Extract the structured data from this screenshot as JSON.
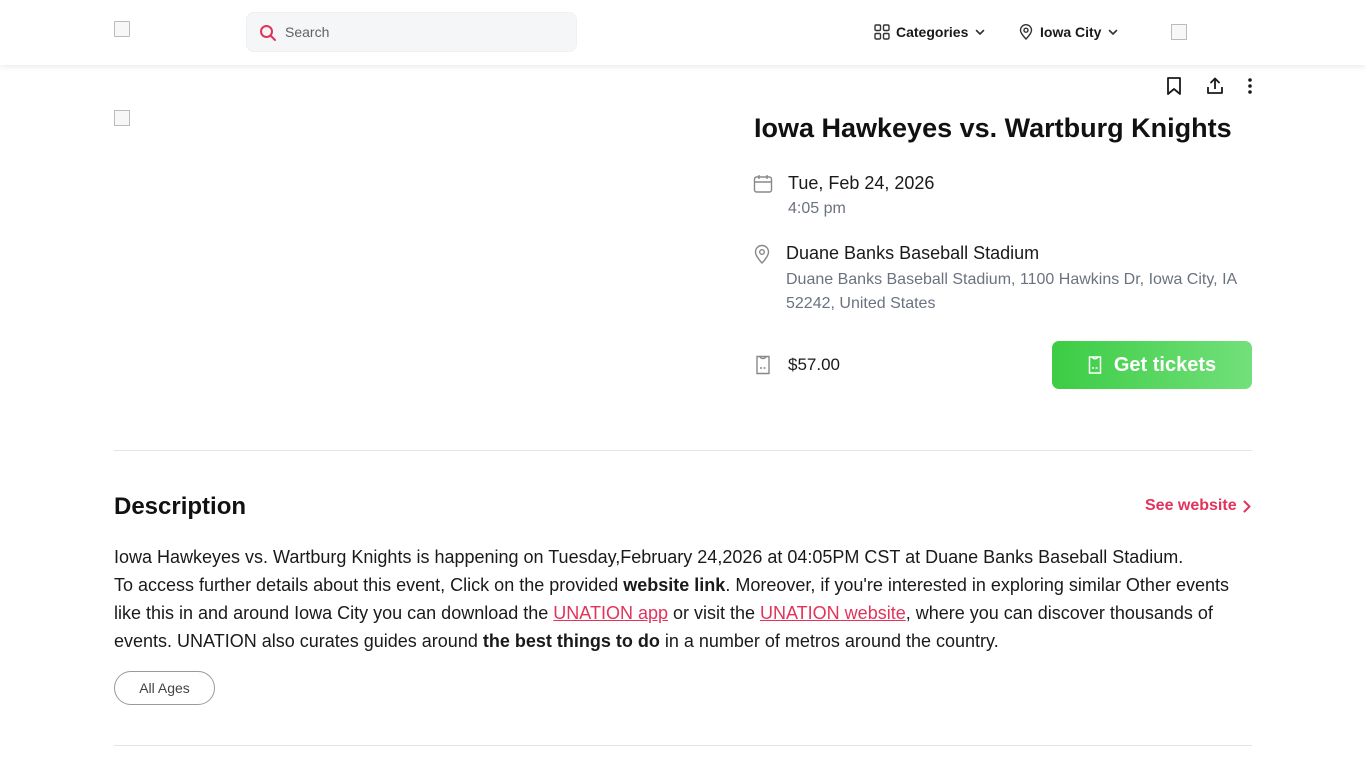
{
  "header": {
    "search_placeholder": "Search",
    "categories_label": "Categories",
    "location_label": "Iowa City"
  },
  "event": {
    "title": "Iowa Hawkeyes vs. Wartburg Knights",
    "date": "Tue, Feb 24, 2026",
    "time": "4:05 pm",
    "venue_name": "Duane Banks Baseball Stadium",
    "venue_address": "Duane Banks Baseball Stadium, 1100 Hawkins Dr, Iowa City, IA 52242, United States",
    "price": "$57.00",
    "tickets_label": "Get tickets"
  },
  "description": {
    "heading": "Description",
    "see_website_label": "See website",
    "line1": "Iowa Hawkeyes vs. Wartburg Knights is happening on Tuesday,February 24,2026 at 04:05PM CST at Duane Banks Baseball Stadium.",
    "p2_a": "To access further details about this event, Click on the provided ",
    "p2_bold1": "website link",
    "p2_b": ". Moreover, if you're interested in exploring similar Other events like this in and around Iowa City you can download the ",
    "p2_link1": "UNATION app",
    "p2_c": " or visit the ",
    "p2_link2": "UNATION website",
    "p2_d": ", where you can discover thousands of events. UNATION also curates guides around ",
    "p2_bold2": "the best things to do",
    "p2_e": " in a number of metros around the country.",
    "tag": "All Ages"
  },
  "colors": {
    "accent": "#e2335a",
    "tickets_green": "#3ccc45"
  },
  "icons": [
    "search-icon",
    "grid-icon",
    "chevron-down-icon",
    "location-pin-icon",
    "bookmark-icon",
    "share-icon",
    "more-vertical-icon",
    "calendar-icon",
    "ticket-icon",
    "chevron-right-icon"
  ]
}
